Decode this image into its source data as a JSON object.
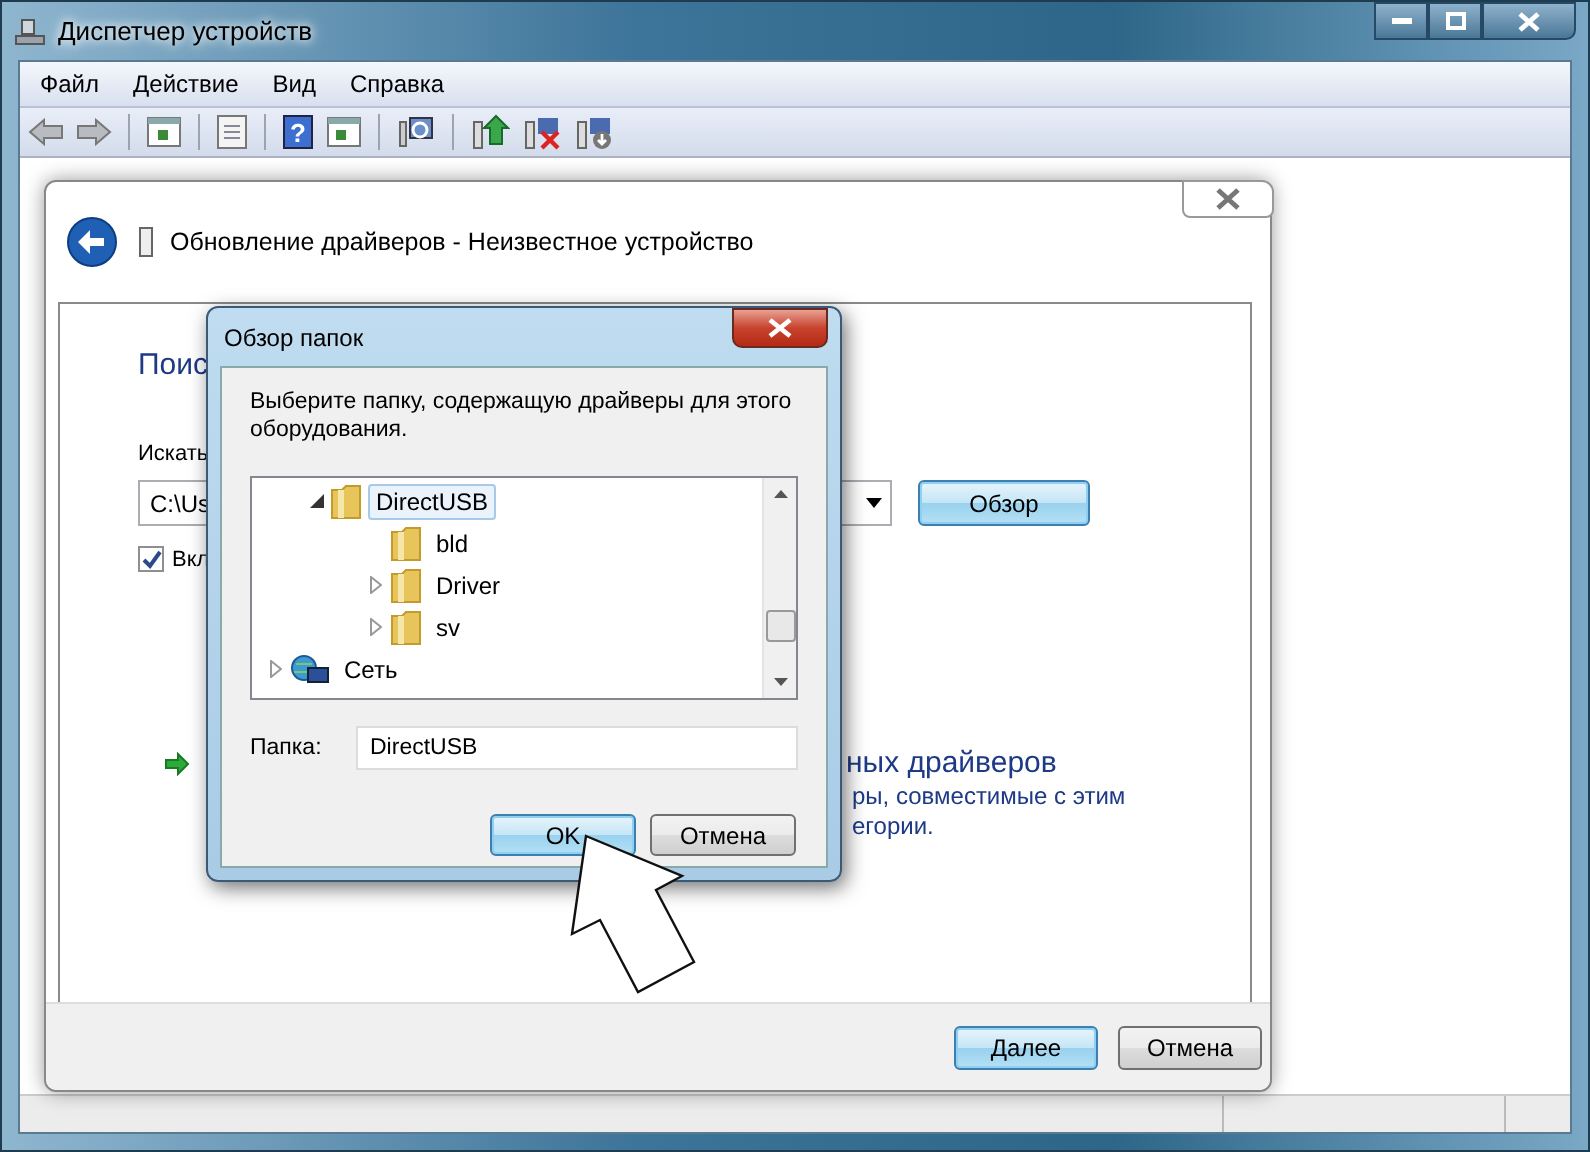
{
  "window": {
    "title": "Диспетчер устройств"
  },
  "menu": [
    "Файл",
    "Действие",
    "Вид",
    "Справка"
  ],
  "toolbar": {
    "help_glyph": "?"
  },
  "wizard": {
    "title": "Обновление драйверов - Неизвестное устройство",
    "heading": "Поис",
    "search_label": "Искать",
    "path_value": "C:\\Us",
    "browse_button": "Обзор",
    "subfolders": {
      "label": "Вкл",
      "checked": true
    },
    "option": {
      "title": "ных драйверов",
      "description": [
        "ры, совместимые с этим",
        "егории."
      ]
    },
    "buttons": [
      {
        "label": "Далее",
        "default": true
      },
      {
        "label": "Отмена",
        "default": false
      }
    ]
  },
  "browse_dialog": {
    "title": "Обзор папок",
    "instruction": "Выберите папку, содержащую драйверы для этого оборудования.",
    "tree": [
      {
        "label": "DirectUSB",
        "kind": "folder",
        "expanded": true,
        "selected": true,
        "children": [
          {
            "label": "bld",
            "kind": "folder",
            "selected": false
          },
          {
            "label": "Driver",
            "kind": "folder",
            "expanded": false,
            "selected": false
          },
          {
            "label": "sv",
            "kind": "folder",
            "expanded": false,
            "selected": false
          }
        ]
      },
      {
        "label": "Сеть",
        "kind": "network",
        "expanded": false,
        "selected": false
      }
    ],
    "folder_label": "Папка:",
    "folder_value": "DirectUSB",
    "buttons": [
      {
        "label": "OK",
        "default": true
      },
      {
        "label": "Отмена",
        "default": false
      }
    ]
  }
}
